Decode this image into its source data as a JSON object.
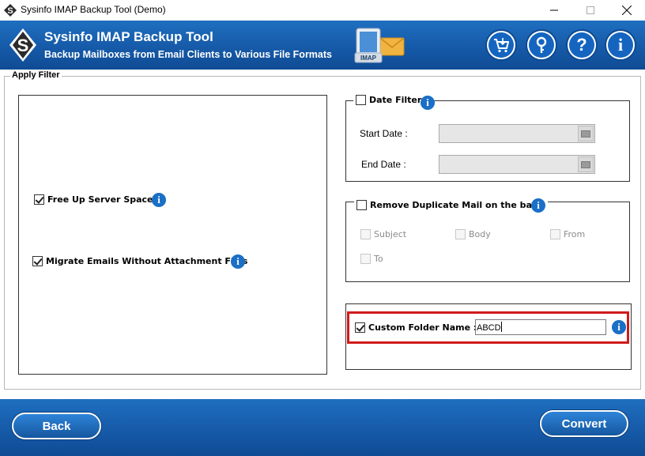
{
  "window": {
    "title": "Sysinfo IMAP Backup Tool (Demo)",
    "controls": [
      "minimize-icon",
      "maximize-icon",
      "close-icon"
    ]
  },
  "header": {
    "title": "Sysinfo IMAP Backup Tool",
    "subtitle": "Backup Mailboxes from Email Clients to Various File Formats",
    "art_label": "IMAP",
    "buttons": [
      "cart-icon",
      "key-icon",
      "help-icon",
      "info-icon"
    ]
  },
  "apply_filter": {
    "legend": "Apply Filter",
    "free_up_server_space": {
      "label": "Free Up Server Space",
      "checked": true
    },
    "migrate_without_attachments": {
      "label": "Migrate Emails Without Attachment Files",
      "checked": true
    }
  },
  "date_filter": {
    "label": "Date Filter",
    "checked": false,
    "start_label": "Start Date :",
    "end_label": "End Date :",
    "start_value": "",
    "end_value": ""
  },
  "duplicates": {
    "label": "Remove Duplicate Mail on the basis",
    "checked": false,
    "options": [
      {
        "label": "Subject",
        "checked": false
      },
      {
        "label": "Body",
        "checked": false
      },
      {
        "label": "From",
        "checked": false
      },
      {
        "label": "To",
        "checked": false
      }
    ]
  },
  "custom_folder": {
    "label": "Custom Folder Name :",
    "checked": true,
    "value": "ABCD"
  },
  "footer": {
    "back_label": "Back",
    "convert_label": "Convert"
  },
  "colors": {
    "brand_blue": "#165aa8",
    "info_blue": "#1a6fc6",
    "highlight_red": "#d01b1b"
  }
}
